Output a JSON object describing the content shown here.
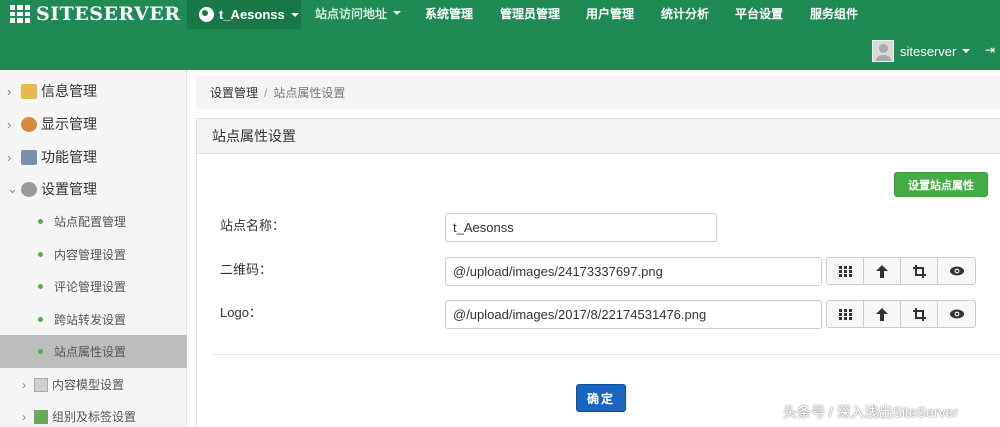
{
  "header": {
    "logo_text": "SITESERVER",
    "site_name": "t_Aesonss",
    "menu": [
      {
        "label": "站点访问地址"
      },
      {
        "label": "系统管理"
      },
      {
        "label": "管理员管理"
      },
      {
        "label": "用户管理"
      },
      {
        "label": "统计分析"
      },
      {
        "label": "平台设置"
      },
      {
        "label": "服务组件"
      }
    ],
    "user_name": "siteserver"
  },
  "sidebar": {
    "groups": [
      {
        "label": "信息管理"
      },
      {
        "label": "显示管理"
      },
      {
        "label": "功能管理"
      },
      {
        "label": "设置管理"
      }
    ],
    "sub_items": [
      {
        "label": "站点配置管理"
      },
      {
        "label": "内容管理设置"
      },
      {
        "label": "评论管理设置"
      },
      {
        "label": "跨站转发设置"
      },
      {
        "label": "站点属性设置"
      }
    ],
    "sub_groups": [
      {
        "label": "内容模型设置"
      },
      {
        "label": "组别及标签设置"
      }
    ]
  },
  "breadcrumb": {
    "parent": "设置管理",
    "separator": "/",
    "current": "站点属性设置"
  },
  "panel": {
    "title": "站点属性设置",
    "set_button": "设置站点属性",
    "fields": {
      "site_name": {
        "label": "站点名称：",
        "value": "t_Aesonss"
      },
      "qrcode": {
        "label": "二维码：",
        "value": "@/upload/images/24173337697.png"
      },
      "logo": {
        "label": "Logo：",
        "value": "@/upload/images/2017/8/22174531476.png"
      }
    },
    "ok_button": "确定"
  },
  "watermark": "头条号 / 深入浅出SiteServer",
  "colors": {
    "header": "#1f8a53",
    "green_button": "#46ad46",
    "blue_button": "#1866bf"
  }
}
